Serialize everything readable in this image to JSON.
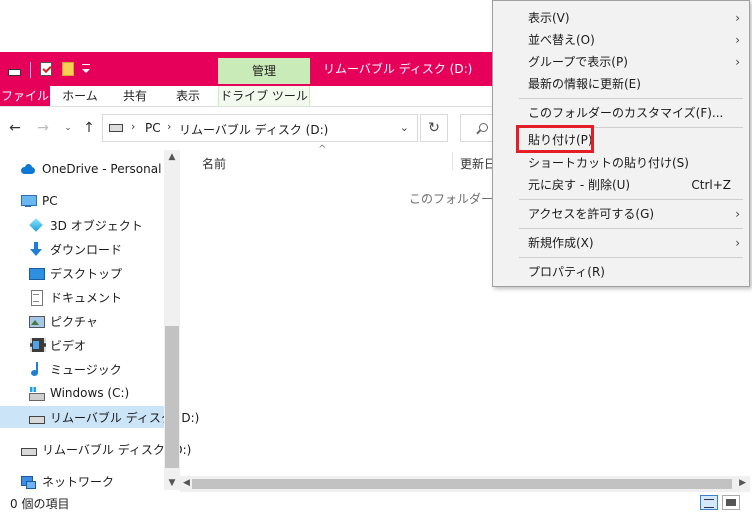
{
  "window": {
    "title": "リムーバブル ディスク (D:)",
    "context_tab": "管理"
  },
  "ribbon": {
    "tabs": [
      "ファイル",
      "ホーム",
      "共有",
      "表示",
      "ドライブ ツール"
    ]
  },
  "address": {
    "pc": "PC",
    "location": "リムーバブル ディスク (D:)"
  },
  "nav_pane": {
    "items": [
      {
        "label": "OneDrive - Personal",
        "icon": "onedrive-cloud-icon"
      },
      {
        "label": "PC",
        "icon": "pc-icon"
      },
      {
        "label": "3D オブジェクト",
        "icon": "3d-objects-icon"
      },
      {
        "label": "ダウンロード",
        "icon": "downloads-icon"
      },
      {
        "label": "デスクトップ",
        "icon": "desktop-icon"
      },
      {
        "label": "ドキュメント",
        "icon": "documents-icon"
      },
      {
        "label": "ピクチャ",
        "icon": "pictures-icon"
      },
      {
        "label": "ビデオ",
        "icon": "videos-icon"
      },
      {
        "label": "ミュージック",
        "icon": "music-icon"
      },
      {
        "label": "Windows (C:)",
        "icon": "windows-drive-icon"
      },
      {
        "label": "リムーバブル ディスク (D:)",
        "icon": "removable-drive-icon",
        "selected": true
      },
      {
        "label": "リムーバブル ディスク (D:)",
        "icon": "removable-drive-icon"
      },
      {
        "label": "ネットワーク",
        "icon": "network-icon"
      }
    ]
  },
  "content": {
    "column_name": "名前",
    "column_date": "更新日時",
    "empty_message": "このフォルダーは空です。"
  },
  "status_bar": {
    "item_count": "0 個の項目"
  },
  "context_menu": {
    "items": [
      {
        "label": "表示(V)",
        "submenu": true
      },
      {
        "label": "並べ替え(O)",
        "submenu": true
      },
      {
        "label": "グループで表示(P)",
        "submenu": true
      },
      {
        "label": "最新の情報に更新(E)"
      },
      {
        "label": "このフォルダーのカスタマイズ(F)..."
      },
      {
        "label": "貼り付け(P)",
        "highlighted": true
      },
      {
        "label": "ショートカットの貼り付け(S)"
      },
      {
        "label": "元に戻す - 削除(U)",
        "shortcut": "Ctrl+Z"
      },
      {
        "label": "アクセスを許可する(G)",
        "submenu": true
      },
      {
        "label": "新規作成(X)",
        "submenu": true
      },
      {
        "label": "プロパティ(R)"
      }
    ]
  },
  "colors": {
    "title_bar": "#e6005a",
    "context_tab": "#c9ebb8",
    "selection": "#cce4f7",
    "highlight_box": "#e41e26"
  }
}
